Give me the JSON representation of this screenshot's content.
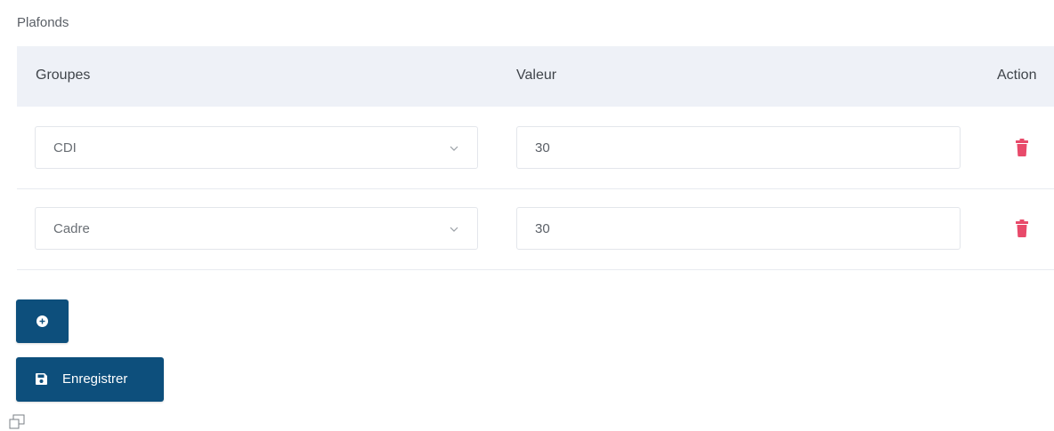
{
  "section": {
    "label": "Plafonds"
  },
  "table": {
    "columns": [
      "Groupes",
      "Valeur",
      "Action"
    ],
    "rows": [
      {
        "group": "CDI",
        "value": "30",
        "action_icon": "trash-icon"
      },
      {
        "group": "Cadre",
        "value": "30",
        "action_icon": "trash-icon"
      }
    ]
  },
  "buttons": {
    "add_icon": "plus-circle-icon",
    "save_label": "Enregistrer",
    "save_icon": "floppy-disk-icon"
  },
  "colors": {
    "primary": "#0d4f7c",
    "danger": "#e84a6a",
    "header_bg": "#eef1f7"
  }
}
